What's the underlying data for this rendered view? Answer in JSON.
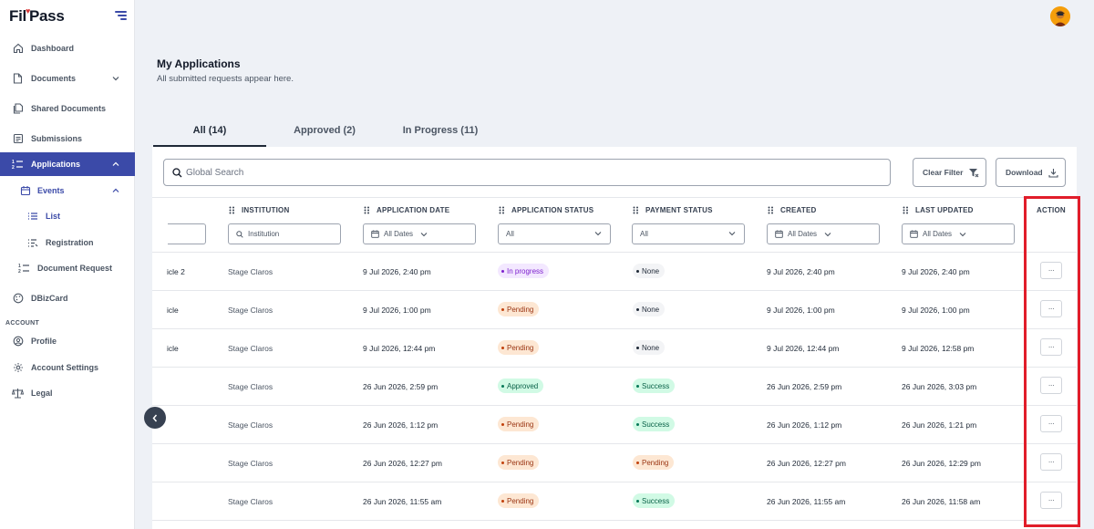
{
  "app": {
    "logo_pre": "Fil",
    "logo_post": "Pass"
  },
  "sidebar": {
    "items": [
      {
        "label": "Dashboard"
      },
      {
        "label": "Documents"
      },
      {
        "label": "Shared Documents"
      },
      {
        "label": "Submissions"
      },
      {
        "label": "Applications"
      },
      {
        "label": "Events"
      },
      {
        "label": "List"
      },
      {
        "label": "Registration"
      },
      {
        "label": "Document Request"
      },
      {
        "label": "DBizCard"
      },
      {
        "label": "Profile"
      },
      {
        "label": "Account Settings"
      },
      {
        "label": "Legal"
      }
    ],
    "section_account": "ACCOUNT",
    "active_color": "#3b4aa8"
  },
  "header": {
    "title": "My Applications",
    "subtitle": "All submitted requests appear here."
  },
  "tabs": [
    {
      "label": "All (14)"
    },
    {
      "label": "Approved (2)"
    },
    {
      "label": "In Progress (11)"
    }
  ],
  "toolbar": {
    "search_placeholder": "Global Search",
    "clear_filter": "Clear Filter",
    "download": "Download"
  },
  "table": {
    "columns": [
      {
        "label": "INSTITUTION"
      },
      {
        "label": "APPLICATION DATE"
      },
      {
        "label": "APPLICATION STATUS"
      },
      {
        "label": "PAYMENT STATUS"
      },
      {
        "label": "CREATED"
      },
      {
        "label": "LAST UPDATED"
      },
      {
        "label": "ACTION"
      }
    ],
    "filters": {
      "institution_placeholder": "Institution",
      "all_dates": "All Dates",
      "all": "All"
    },
    "action_label": "···",
    "rows": [
      {
        "truncated": "icle 2",
        "institution": "Stage Claros",
        "app_date": "9 Jul 2026, 2:40 pm",
        "app_status": "In progress",
        "pay_status": "None",
        "created": "9 Jul 2026, 2:40 pm",
        "updated": "9 Jul 2026, 2:40 pm"
      },
      {
        "truncated": "icle",
        "institution": "Stage Claros",
        "app_date": "9 Jul 2026, 1:00 pm",
        "app_status": "Pending",
        "pay_status": "None",
        "created": "9 Jul 2026, 1:00 pm",
        "updated": "9 Jul 2026, 1:00 pm"
      },
      {
        "truncated": "icle",
        "institution": "Stage Claros",
        "app_date": "9 Jul 2026, 12:44 pm",
        "app_status": "Pending",
        "pay_status": "None",
        "created": "9 Jul 2026, 12:44 pm",
        "updated": "9 Jul 2026, 12:58 pm"
      },
      {
        "truncated": "",
        "institution": "Stage Claros",
        "app_date": "26 Jun 2026, 2:59 pm",
        "app_status": "Approved",
        "pay_status": "Success",
        "created": "26 Jun 2026, 2:59 pm",
        "updated": "26 Jun 2026, 3:03 pm"
      },
      {
        "truncated": "",
        "institution": "Stage Claros",
        "app_date": "26 Jun 2026, 1:12 pm",
        "app_status": "Pending",
        "pay_status": "Success",
        "created": "26 Jun 2026, 1:12 pm",
        "updated": "26 Jun 2026, 1:21 pm"
      },
      {
        "truncated": "",
        "institution": "Stage Claros",
        "app_date": "26 Jun 2026, 12:27 pm",
        "app_status": "Pending",
        "pay_status": "Pending",
        "created": "26 Jun 2026, 12:27 pm",
        "updated": "26 Jun 2026, 12:29 pm"
      },
      {
        "truncated": "",
        "institution": "Stage Claros",
        "app_date": "26 Jun 2026, 11:55 am",
        "app_status": "Pending",
        "pay_status": "Success",
        "created": "26 Jun 2026, 11:55 am",
        "updated": "26 Jun 2026, 11:58 am"
      }
    ]
  },
  "highlight_color": "#e11d2a"
}
